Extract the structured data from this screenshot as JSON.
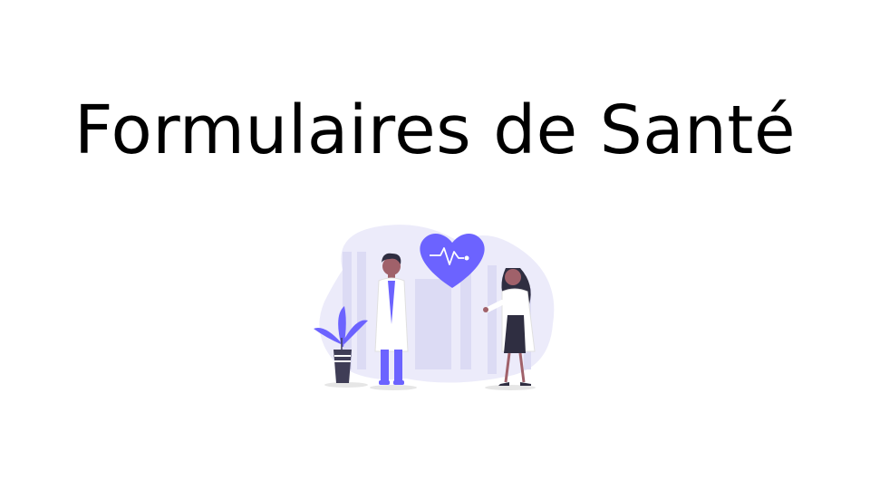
{
  "slide": {
    "title": "Formulaires de Santé"
  },
  "illustration": {
    "subject": "doctors-heart-rate",
    "colors": {
      "accent": "#6C63FF",
      "backdrop": "#ECEBFA",
      "backdrop_dark": "#DCDBF4",
      "skin": "#A0616A",
      "hair": "#2F2E41",
      "coat": "#FFFFFF",
      "pot": "#3F3D56"
    }
  }
}
